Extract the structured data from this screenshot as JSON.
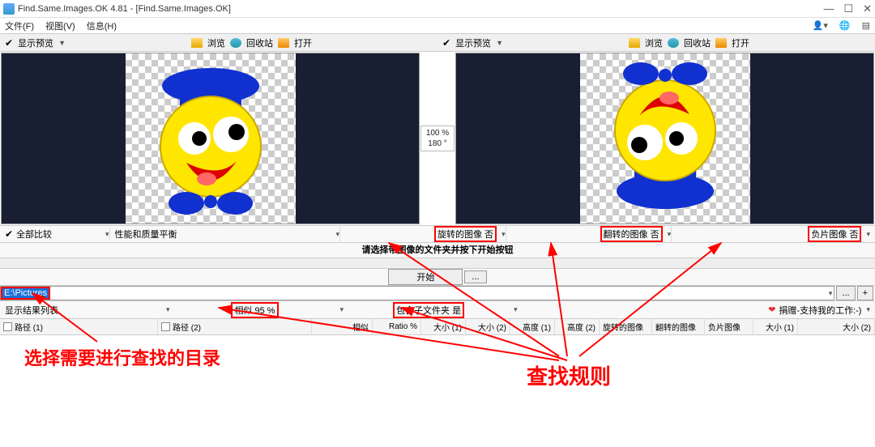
{
  "window": {
    "title": "Find.Same.Images.OK 4.81 - [Find.Same.Images.OK]",
    "min": "—",
    "max": "☐",
    "close": "✕"
  },
  "menu": {
    "file": "文件(F)",
    "view": "视图(V)",
    "info": "信息(H)"
  },
  "tool": {
    "show_preview": "显示预览",
    "browse": "浏览",
    "recycle": "回收站",
    "open": "打开"
  },
  "center": {
    "zoom": "100 %",
    "rotation": "180 °"
  },
  "ctrl": {
    "all_compare": "全部比较",
    "perf": "性能和质量平衡",
    "rotate": "旋转的图像 否",
    "flip": "翻转的图像 否",
    "neg": "负片图像 否"
  },
  "hint": "请选择带图像的文件夹并按下开始按钮",
  "start": "开始",
  "dots": "...",
  "path": {
    "value": "E:\\Pictures"
  },
  "opts": {
    "show_results": "显示结果列表",
    "similar": "相似 95 %",
    "subfolders": "包含子文件夹 是",
    "donate": "捐赠-支持我的工作:-)"
  },
  "cols": {
    "path1": "路径 (1)",
    "path2": "路径 (2)",
    "similar": "相似",
    "ratio": "Ratio %",
    "size1": "大小 (1)",
    "size2": "大小 (2)",
    "height1": "高度 (1)",
    "height2": "高度 (2)",
    "rotimg": "旋转的图像",
    "flipimg": "翻转的图像",
    "negimg": "负片图像",
    "fsize1": "大小 (1)",
    "fsize2": "大小 (2)"
  },
  "ann": {
    "select_dir": "选择需要进行查找的目录",
    "rules": "查找规则"
  },
  "addbtn": "+"
}
